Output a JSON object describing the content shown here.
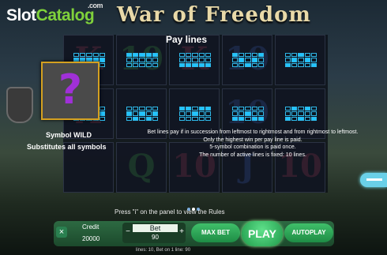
{
  "logo": {
    "slot": "Slot",
    "catalog": "Catalog",
    "com": ".com"
  },
  "game_title": "War of Freedom",
  "paylines_title": "Pay lines",
  "wild": {
    "symbol": "?",
    "line1": "Symbol WILD",
    "line2": "Substitutes all symbols"
  },
  "rules": [
    "Bet lines pay if in succession from leftmost to rightmost and from rightmost to leftmost.",
    "Only the highest win per pay line is paid.",
    "5-symbol combination is paid once.",
    "The number of active lines is fixed: 10 lines."
  ],
  "ghost_symbols": [
    "K",
    "10",
    "K",
    "10",
    "",
    "A",
    "",
    "",
    "10",
    "",
    "",
    "Q",
    "10",
    "J",
    "10"
  ],
  "paylines": [
    [
      [
        0,
        0,
        0,
        0,
        0
      ],
      [
        1,
        1,
        1,
        1,
        1
      ],
      [
        0,
        0,
        0,
        0,
        0
      ]
    ],
    [
      [
        1,
        1,
        1,
        1,
        1
      ],
      [
        0,
        0,
        0,
        0,
        0
      ],
      [
        0,
        0,
        0,
        0,
        0
      ]
    ],
    [
      [
        0,
        0,
        0,
        0,
        0
      ],
      [
        0,
        0,
        0,
        0,
        0
      ],
      [
        1,
        1,
        1,
        1,
        1
      ]
    ],
    [
      [
        1,
        0,
        0,
        0,
        1
      ],
      [
        0,
        1,
        0,
        1,
        0
      ],
      [
        0,
        0,
        1,
        0,
        0
      ]
    ],
    [
      [
        0,
        0,
        1,
        0,
        0
      ],
      [
        0,
        1,
        0,
        1,
        0
      ],
      [
        1,
        0,
        0,
        0,
        1
      ]
    ],
    [
      [
        0,
        1,
        0,
        1,
        0
      ],
      [
        1,
        0,
        1,
        0,
        1
      ],
      [
        0,
        0,
        0,
        0,
        0
      ]
    ],
    [
      [
        0,
        0,
        0,
        0,
        0
      ],
      [
        1,
        0,
        1,
        0,
        1
      ],
      [
        0,
        1,
        0,
        1,
        0
      ]
    ],
    [
      [
        1,
        1,
        0,
        1,
        1
      ],
      [
        0,
        0,
        1,
        0,
        0
      ],
      [
        0,
        0,
        0,
        0,
        0
      ]
    ],
    [
      [
        0,
        0,
        0,
        0,
        0
      ],
      [
        0,
        0,
        1,
        0,
        0
      ],
      [
        1,
        1,
        0,
        1,
        1
      ]
    ],
    [
      [
        0,
        1,
        0,
        1,
        0
      ],
      [
        0,
        0,
        0,
        0,
        0
      ],
      [
        1,
        0,
        1,
        0,
        1
      ]
    ]
  ],
  "press_hint": "Press \"i\" on the panel to view the Rules",
  "panel": {
    "close": "×",
    "credit_label": "Credit",
    "credit_value": "20000",
    "bet_minus": "−",
    "bet_label": "Bet",
    "bet_value": "90",
    "bet_plus": "+",
    "max_bet": "MAX BET",
    "play": "PLAY",
    "autoplay": "AUTOPLAY",
    "status": "lines: 10,   Bet on 1 line: 90"
  }
}
